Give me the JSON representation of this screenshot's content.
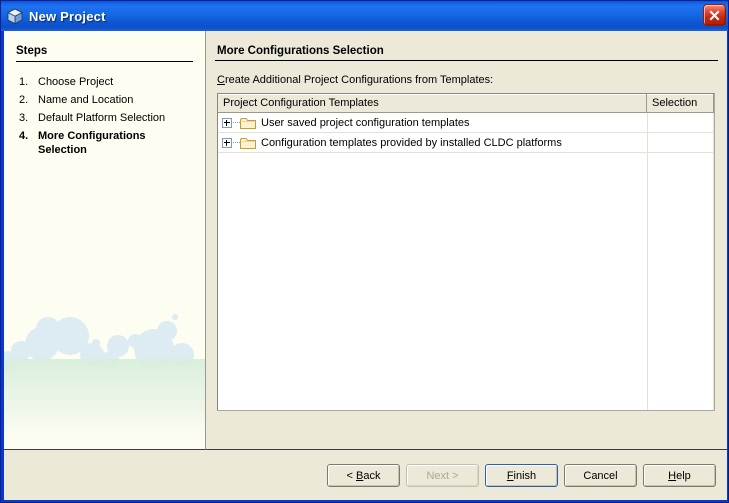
{
  "window": {
    "title": "New Project",
    "icon": "cube-icon",
    "close_label": "x",
    "frame_color": "#0A38C8",
    "titlebar_color": "#1668E4"
  },
  "steps_panel": {
    "heading": "Steps",
    "items": [
      {
        "number": "1.",
        "label": "Choose Project",
        "current": false
      },
      {
        "number": "2.",
        "label": "Name and Location",
        "current": false
      },
      {
        "number": "3.",
        "label": "Default Platform Selection",
        "current": false
      },
      {
        "number": "4.",
        "label": "More Configurations Selection",
        "current": true
      }
    ]
  },
  "main": {
    "title": "More Configurations Selection",
    "prompt_mnemonic": "C",
    "prompt_rest": "reate Additional Project Configurations from Templates:",
    "table": {
      "columns": [
        {
          "label": "Project Configuration Templates"
        },
        {
          "label": "Selection"
        }
      ],
      "rows": [
        {
          "label": "User saved project configuration templates",
          "expander": "plus",
          "icon": "folder-icon",
          "selection": ""
        },
        {
          "label": "Configuration templates provided by installed CLDC platforms",
          "expander": "plus",
          "icon": "folder-icon",
          "selection": ""
        }
      ]
    }
  },
  "buttons": {
    "back": {
      "pre": "< ",
      "mnemonic": "B",
      "post": "ack"
    },
    "next": {
      "label": "Next >"
    },
    "finish": {
      "pre": "",
      "mnemonic": "F",
      "post": "inish"
    },
    "cancel": {
      "label": "Cancel"
    },
    "help": {
      "pre": "",
      "mnemonic": "H",
      "post": "elp"
    }
  },
  "colors": {
    "dialog_bg": "#ECE9D8",
    "steps_bg": "#FDFDF2",
    "table_bg": "#FFFFFF",
    "folder_fill": "#FCF2CC",
    "folder_stroke": "#C79A3A",
    "default_button_border": "#2C5FA8"
  }
}
